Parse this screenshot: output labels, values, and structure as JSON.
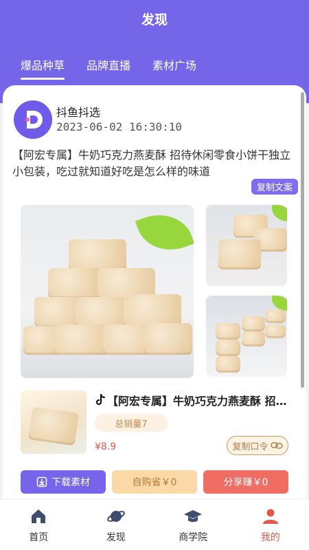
{
  "header": {
    "title": "发现"
  },
  "tabs": [
    {
      "label": "爆品种草",
      "active": true
    },
    {
      "label": "品牌直播",
      "active": false
    },
    {
      "label": "素材广场",
      "active": false
    }
  ],
  "post": {
    "author": "抖鱼抖选",
    "avatar_icon": "douyu-logo",
    "time": "2023-06-02 16:30:10",
    "description": "【阿宏专属】牛奶巧克力燕麦酥 招待休闲零食小饼干独立小包装，吃过就知道好吃是怎么样的味道",
    "copy_text_label": "复制文案"
  },
  "product": {
    "platform_icon": "tiktok-icon",
    "title": "【阿宏专属】牛奶巧克力燕麦酥 招待休闲零食小饼干",
    "sales": "总销量7",
    "price": "¥8.9",
    "copy_code_label": "复制口令"
  },
  "actions": {
    "download": "下载素材",
    "self_buy": "自购省￥0",
    "share": "分享赚￥0"
  },
  "nav": [
    {
      "label": "首页",
      "icon": "home-icon",
      "active": false
    },
    {
      "label": "发现",
      "icon": "planet-icon",
      "active": false
    },
    {
      "label": "商学院",
      "icon": "graduation-cap-icon",
      "active": false
    },
    {
      "label": "我的",
      "icon": "person-icon",
      "active": true
    }
  ],
  "colors": {
    "primary": "#7465e9",
    "accent": "#e4574a",
    "gold": "#c89b62"
  }
}
